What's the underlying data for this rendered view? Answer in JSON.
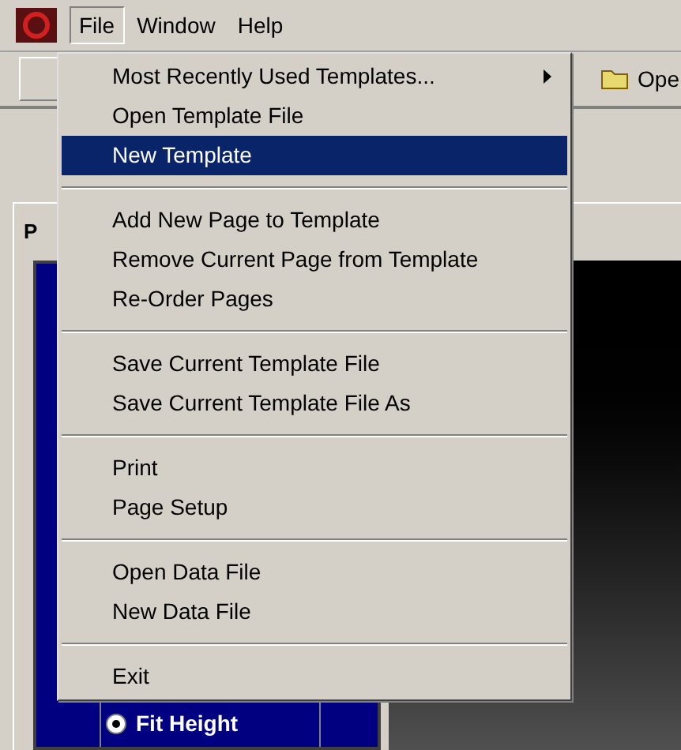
{
  "menubar": [
    {
      "label": "File",
      "selected": true
    },
    {
      "label": "Window",
      "selected": false
    },
    {
      "label": "Help",
      "selected": false
    }
  ],
  "file_menu": [
    {
      "kind": "item",
      "label": "Most Recently Used Templates...",
      "submenu": true,
      "selected": false
    },
    {
      "kind": "item",
      "label": "Open Template File",
      "submenu": false,
      "selected": false
    },
    {
      "kind": "item",
      "label": "New Template",
      "submenu": false,
      "selected": true
    },
    {
      "kind": "separator"
    },
    {
      "kind": "item",
      "label": "Add New Page to Template",
      "submenu": false,
      "selected": false
    },
    {
      "kind": "item",
      "label": "Remove Current Page from Template",
      "submenu": false,
      "selected": false
    },
    {
      "kind": "item",
      "label": "Re-Order Pages",
      "submenu": false,
      "selected": false
    },
    {
      "kind": "separator"
    },
    {
      "kind": "item",
      "label": "Save Current Template File",
      "submenu": false,
      "selected": false
    },
    {
      "kind": "item",
      "label": "Save Current Template File As",
      "submenu": false,
      "selected": false
    },
    {
      "kind": "separator"
    },
    {
      "kind": "item",
      "label": "Print",
      "submenu": false,
      "selected": false
    },
    {
      "kind": "item",
      "label": "Page Setup",
      "submenu": false,
      "selected": false
    },
    {
      "kind": "separator"
    },
    {
      "kind": "item",
      "label": "Open Data File",
      "submenu": false,
      "selected": false
    },
    {
      "kind": "item",
      "label": "New Data File",
      "submenu": false,
      "selected": false
    },
    {
      "kind": "separator"
    },
    {
      "kind": "item",
      "label": "Exit",
      "submenu": false,
      "selected": false
    }
  ],
  "toolbar": {
    "open_button": "Ope"
  },
  "panel": {
    "tab": "P",
    "fit_options": [
      {
        "label": "Fit Height",
        "selected": true
      }
    ]
  }
}
